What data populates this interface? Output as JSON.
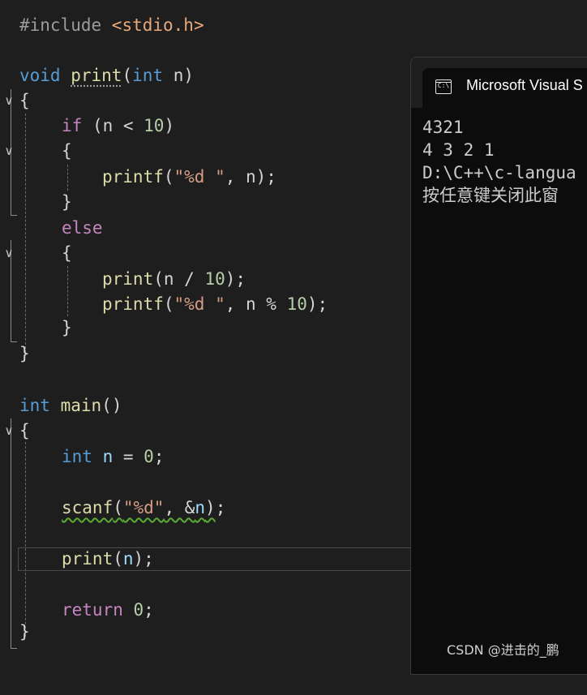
{
  "editor": {
    "lines": {
      "l1": {
        "pre": "#include ",
        "inc": "<stdio.h>"
      },
      "l2": {
        "kw": "void",
        "sp": " ",
        "fn": "print",
        "p1": "(",
        "kw2": "int",
        "var": " n",
        "p2": ")"
      },
      "l3": {
        "text": "{"
      },
      "l4": {
        "ctl": "if",
        "a": " (n < ",
        "num": "10",
        "b": ")"
      },
      "l5": {
        "text": "{"
      },
      "l6": {
        "fn": "printf",
        "a": "(",
        "str": "\"%d \"",
        "b": ", n);"
      },
      "l7": {
        "text": "}"
      },
      "l8": {
        "ctl": "else"
      },
      "l9": {
        "text": "{"
      },
      "l10": {
        "fn": "print",
        "a": "(n / ",
        "num": "10",
        "b": ");"
      },
      "l11": {
        "fn": "printf",
        "a": "(",
        "str": "\"%d \"",
        "b": ", n % ",
        "num": "10",
        "c": ");"
      },
      "l12": {
        "text": "}"
      },
      "l13": {
        "text": "}"
      },
      "l14": {
        "kw": "int",
        "sp": " ",
        "fn": "main",
        "p": "()"
      },
      "l15": {
        "text": "{"
      },
      "l16": {
        "kw": "int",
        "var": " n",
        "a": " = ",
        "num": "0",
        "b": ";"
      },
      "l17": {
        "fn": "scanf",
        "a": "(",
        "str": "\"%d\"",
        "b": ", &",
        "var": "n",
        "c": ")",
        "d": ";"
      },
      "l18": {
        "fn": "print",
        "a": "(",
        "var": "n",
        "b": ");"
      },
      "l19": {
        "ctl": "return",
        "a": " ",
        "num": "0",
        "b": ";"
      },
      "l20": {
        "text": "}"
      }
    },
    "fold_glyph": "∨"
  },
  "console": {
    "title": "Microsoft Visual S",
    "icon_text": "C:\\",
    "output": [
      "4321",
      "4 3 2 1",
      "D:\\C++\\c-langua",
      "按任意键关闭此窗"
    ]
  },
  "watermark": "CSDN @进击的_鹏",
  "colors": {
    "background": "#1e1e1e",
    "keyword": "#569cd6",
    "control": "#c586c0",
    "function": "#dcdcaa",
    "string": "#d69d85",
    "number": "#b5cea8",
    "variable": "#9cdcfe",
    "console_bg": "#0c0c0c"
  }
}
